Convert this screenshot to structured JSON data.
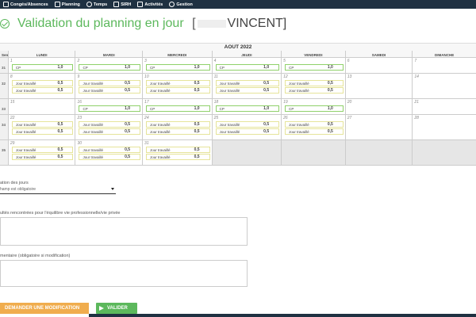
{
  "nav": {
    "items": [
      {
        "label": "Congés/Absences",
        "icon": "calendar-icon"
      },
      {
        "label": "Planning",
        "icon": "planning-icon"
      },
      {
        "label": "Temps",
        "icon": "clock-icon"
      },
      {
        "label": "SIRH",
        "icon": "chat-icon"
      },
      {
        "label": "Activités",
        "icon": "check-icon"
      },
      {
        "label": "Gestion",
        "icon": "plus-circle-icon"
      }
    ]
  },
  "page": {
    "title": "Validation du planning en jour",
    "bracket_open": "[",
    "name": "VINCENT]"
  },
  "calendar": {
    "month": "AOUT 2022",
    "week_header": "Sem.",
    "days": [
      "LUNDI",
      "MARDI",
      "MERCREDI",
      "JEUDI",
      "VENDREDI",
      "SAMEDI",
      "DIMANCHE"
    ],
    "weeks": [
      {
        "label": "31",
        "cells": [
          {
            "num": "1",
            "entries": [
              {
                "type": "cp",
                "label": "CP",
                "value": "1,0"
              }
            ]
          },
          {
            "num": "2",
            "entries": [
              {
                "type": "cp",
                "label": "CP",
                "value": "1,0"
              }
            ]
          },
          {
            "num": "3",
            "entries": [
              {
                "type": "cp",
                "label": "CP",
                "value": "1,0"
              }
            ]
          },
          {
            "num": "4",
            "entries": [
              {
                "type": "cp",
                "label": "CP",
                "value": "1,0"
              }
            ]
          },
          {
            "num": "5",
            "entries": [
              {
                "type": "cp",
                "label": "CP",
                "value": "1,0"
              }
            ]
          },
          {
            "num": "6",
            "entries": []
          },
          {
            "num": "7",
            "entries": []
          }
        ]
      },
      {
        "label": "32",
        "cells": [
          {
            "num": "8",
            "entries": [
              {
                "type": "jt",
                "label": "Jour travaillé",
                "value": "0,5"
              },
              {
                "type": "jt",
                "label": "Jour travaillé",
                "value": "0,5"
              }
            ]
          },
          {
            "num": "9",
            "entries": [
              {
                "type": "jt",
                "label": "Jour travaillé",
                "value": "0,5"
              },
              {
                "type": "jt",
                "label": "Jour travaillé",
                "value": "0,5"
              }
            ]
          },
          {
            "num": "10",
            "entries": [
              {
                "type": "jt",
                "label": "Jour travaillé",
                "value": "0,5"
              },
              {
                "type": "jt",
                "label": "Jour travaillé",
                "value": "0,5"
              }
            ]
          },
          {
            "num": "11",
            "entries": [
              {
                "type": "jt",
                "label": "Jour travaillé",
                "value": "0,5"
              },
              {
                "type": "jt",
                "label": "Jour travaillé",
                "value": "0,5"
              }
            ]
          },
          {
            "num": "12",
            "entries": [
              {
                "type": "jt",
                "label": "Jour travaillé",
                "value": "0,5"
              },
              {
                "type": "jt",
                "label": "Jour travaillé",
                "value": "0,5"
              }
            ]
          },
          {
            "num": "13",
            "entries": []
          },
          {
            "num": "14",
            "entries": []
          }
        ]
      },
      {
        "label": "33",
        "cells": [
          {
            "num": "15",
            "entries": []
          },
          {
            "num": "16",
            "entries": [
              {
                "type": "cp",
                "label": "CP",
                "value": "1,0"
              }
            ]
          },
          {
            "num": "17",
            "entries": [
              {
                "type": "cp",
                "label": "CP",
                "value": "1,0"
              }
            ]
          },
          {
            "num": "18",
            "entries": [
              {
                "type": "cp",
                "label": "CP",
                "value": "1,0"
              }
            ]
          },
          {
            "num": "19",
            "entries": [
              {
                "type": "cp",
                "label": "CP",
                "value": "1,0"
              }
            ]
          },
          {
            "num": "20",
            "entries": []
          },
          {
            "num": "21",
            "entries": []
          }
        ]
      },
      {
        "label": "34",
        "cells": [
          {
            "num": "22",
            "entries": [
              {
                "type": "jt",
                "label": "Jour travaillé",
                "value": "0,5"
              },
              {
                "type": "jt",
                "label": "Jour travaillé",
                "value": "0,5"
              }
            ]
          },
          {
            "num": "23",
            "entries": [
              {
                "type": "jt",
                "label": "Jour travaillé",
                "value": "0,5"
              },
              {
                "type": "jt",
                "label": "Jour travaillé",
                "value": "0,5"
              }
            ]
          },
          {
            "num": "24",
            "entries": [
              {
                "type": "jt",
                "label": "Jour travaillé",
                "value": "0,5"
              },
              {
                "type": "jt",
                "label": "Jour travaillé",
                "value": "0,5"
              }
            ]
          },
          {
            "num": "25",
            "entries": [
              {
                "type": "jt",
                "label": "Jour travaillé",
                "value": "0,5"
              },
              {
                "type": "jt",
                "label": "Jour travaillé",
                "value": "0,5"
              }
            ]
          },
          {
            "num": "26",
            "entries": [
              {
                "type": "jt",
                "label": "Jour travaillé",
                "value": "0,5"
              },
              {
                "type": "jt",
                "label": "Jour travaillé",
                "value": "0,5"
              }
            ]
          },
          {
            "num": "27",
            "entries": []
          },
          {
            "num": "28",
            "entries": []
          }
        ]
      },
      {
        "label": "35",
        "cells": [
          {
            "num": "29",
            "entries": [
              {
                "type": "jt",
                "label": "Jour travaillé",
                "value": "0,5"
              },
              {
                "type": "jt",
                "label": "Jour travaillé",
                "value": "0,5"
              }
            ]
          },
          {
            "num": "30",
            "entries": [
              {
                "type": "jt",
                "label": "Jour travaillé",
                "value": "0,5"
              },
              {
                "type": "jt",
                "label": "Jour travaillé",
                "value": "0,5"
              }
            ]
          },
          {
            "num": "31",
            "entries": [
              {
                "type": "jt",
                "label": "Jour travaillé",
                "value": "0,5"
              },
              {
                "type": "jt",
                "label": "Jour travaillé",
                "value": "0,5"
              }
            ]
          },
          {
            "num": "",
            "entries": [],
            "empty": true
          },
          {
            "num": "",
            "entries": [],
            "empty": true
          },
          {
            "num": "",
            "entries": [],
            "empty": true
          },
          {
            "num": "",
            "entries": [],
            "empty": true
          }
        ]
      }
    ]
  },
  "form": {
    "validation_label": "ation des jours",
    "validation_placeholder": "hamp est obligatoire",
    "difficulties_label": "ultés rencontrées pour l'équilibre vie professionnelle/vie privée",
    "comment_label": "mentaire (obligatoire si modification)"
  },
  "actions": {
    "request_label": "DEMANDER UNE MODIFICATION",
    "validate_label": "VALIDER"
  },
  "colors": {
    "accent": "#5cb85c",
    "warning": "#f0ad4e",
    "nav_bg": "#1f3142",
    "cp_border": "#8fd16a",
    "jt_border": "#e6e49a"
  }
}
